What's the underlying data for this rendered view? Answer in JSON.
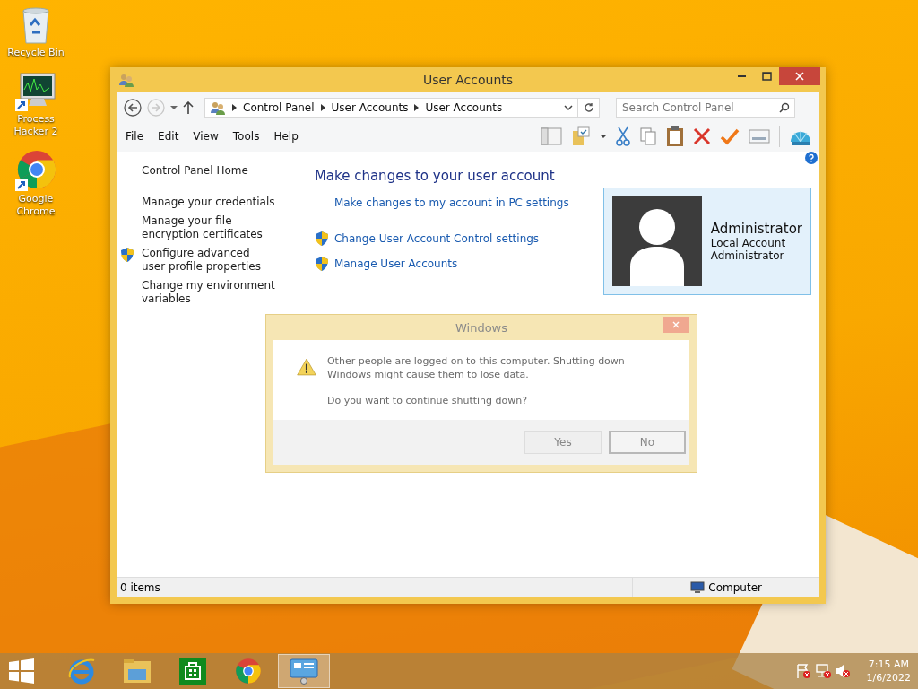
{
  "desktop_icons": [
    {
      "kind": "recycle",
      "label": "Recycle Bin"
    },
    {
      "kind": "monitor",
      "label": "Process Hacker 2"
    },
    {
      "kind": "chrome",
      "label": "Google Chrome"
    }
  ],
  "window": {
    "title": "User Accounts",
    "nav_buttons": [
      {
        "kind": "back",
        "disabled": false
      },
      {
        "kind": "forward",
        "disabled": true
      }
    ],
    "breadcrumb": [
      "Control Panel",
      "User Accounts",
      "User Accounts"
    ],
    "search": {
      "placeholder": "Search Control Panel"
    },
    "menu": [
      "File",
      "Edit",
      "View",
      "Tools",
      "Help"
    ],
    "sidebar": [
      {
        "label": "Control Panel Home",
        "shield": false
      },
      {
        "label": "Manage your credentials",
        "shield": false
      },
      {
        "label": "Manage your file encryption certificates",
        "shield": false
      },
      {
        "label": "Configure advanced user profile properties",
        "shield": true
      },
      {
        "label": "Change my environment variables",
        "shield": false
      }
    ],
    "heading": "Make changes to your user account",
    "links": [
      {
        "label": "Make changes to my account in PC settings",
        "shield": false
      },
      {
        "label": "Change User Account Control settings",
        "shield": true
      },
      {
        "label": "Manage User Accounts",
        "shield": true
      }
    ],
    "account": {
      "name": "Administrator",
      "lines": [
        "Local Account",
        "Administrator"
      ]
    },
    "status_bar": {
      "items": "0 items",
      "location": "Computer"
    }
  },
  "dialog": {
    "title": "Windows",
    "message": "Other people are logged on to this computer. Shutting down Windows might cause them to lose data.",
    "question": "Do you want to continue shutting down?",
    "buttons": [
      {
        "label": "Yes",
        "focused": false
      },
      {
        "label": "No",
        "focused": true
      }
    ]
  },
  "taskbar": {
    "apps": [
      {
        "kind": "explorer-ie",
        "selected": false
      },
      {
        "kind": "folder",
        "selected": false
      },
      {
        "kind": "store",
        "selected": false
      },
      {
        "kind": "chrome",
        "selected": false
      },
      {
        "kind": "control-panel",
        "selected": true
      }
    ],
    "time": "7:15 AM",
    "date": "1/6/2022"
  }
}
